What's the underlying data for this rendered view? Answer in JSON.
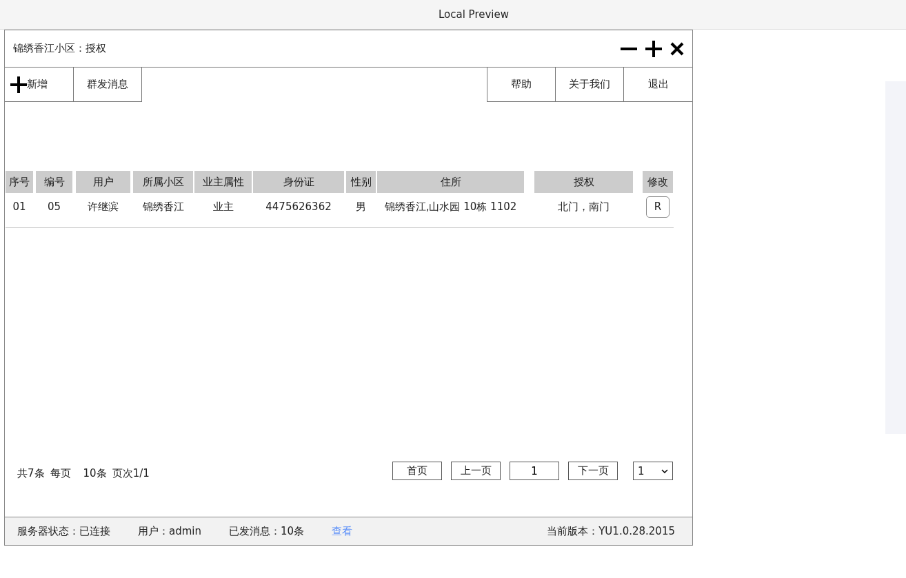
{
  "app": {
    "title": "Local Preview"
  },
  "window": {
    "title": "锦绣香江小区：授权"
  },
  "toolbar": {
    "left": [
      {
        "label": "新增",
        "kind": "add"
      },
      {
        "label": "群发消息",
        "kind": "plain"
      }
    ],
    "right": [
      {
        "label": "帮助",
        "kind": "plain"
      },
      {
        "label": "关于我们",
        "kind": "plain"
      },
      {
        "label": "退出",
        "kind": "plain"
      }
    ]
  },
  "table": {
    "columns": [
      "序号",
      "编号",
      "用户",
      "所属小区",
      "业主属性",
      "身份证",
      "性别",
      "住所",
      "授权",
      "修改"
    ],
    "rows": [
      {
        "cells": [
          "01",
          "05",
          "许继滨",
          "锦绣香江",
          "业主",
          "4475626362",
          "男",
          "锦绣香江,山水园 10栋 1102",
          "北门，南门"
        ],
        "action": "R"
      }
    ]
  },
  "pagination": {
    "summary": [
      "共7条",
      "每页",
      "10条",
      "页次1/1"
    ],
    "first": "首页",
    "prev": "上一页",
    "page": "1",
    "next": "下一页",
    "select": "1"
  },
  "status_bar": {
    "items": [
      {
        "text": "服务器状态：已连接",
        "kind": "text"
      },
      {
        "text": "用户：admin",
        "kind": "text"
      },
      {
        "text": "已发消息：10条",
        "kind": "text"
      },
      {
        "text": "查看",
        "kind": "link"
      }
    ],
    "version": "当前版本：YU1.0.28.2015"
  }
}
